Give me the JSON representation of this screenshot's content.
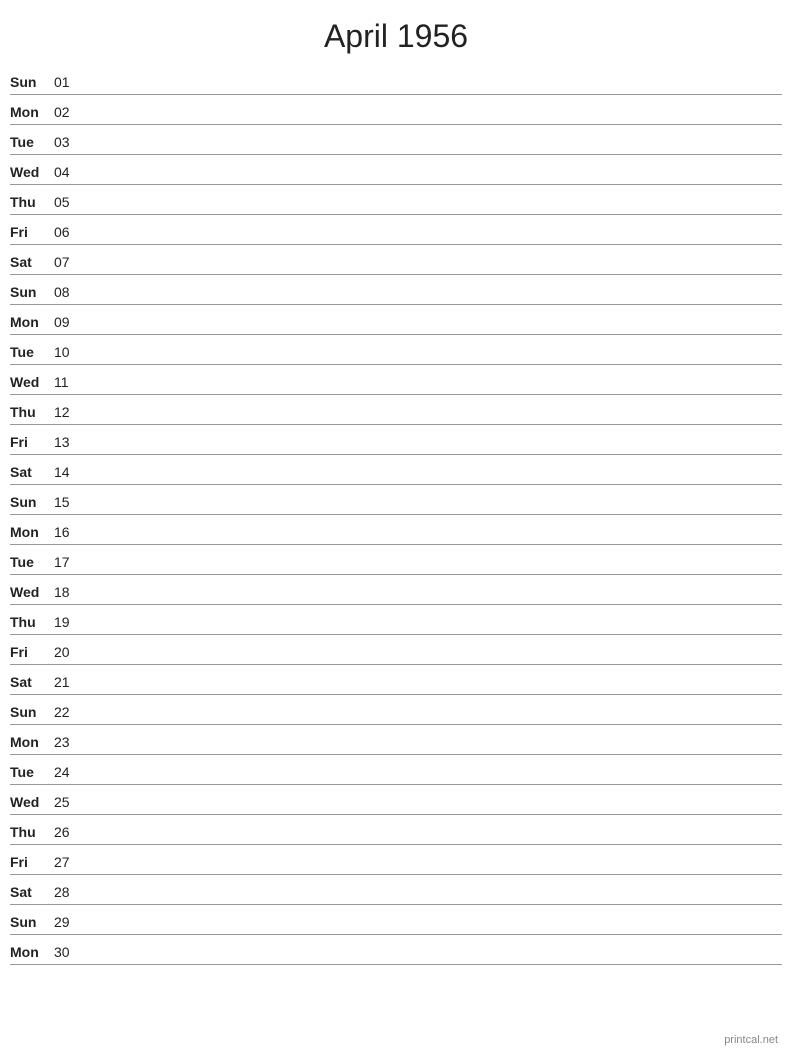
{
  "title": "April 1956",
  "footer": "printcal.net",
  "days": [
    {
      "name": "Sun",
      "number": "01"
    },
    {
      "name": "Mon",
      "number": "02"
    },
    {
      "name": "Tue",
      "number": "03"
    },
    {
      "name": "Wed",
      "number": "04"
    },
    {
      "name": "Thu",
      "number": "05"
    },
    {
      "name": "Fri",
      "number": "06"
    },
    {
      "name": "Sat",
      "number": "07"
    },
    {
      "name": "Sun",
      "number": "08"
    },
    {
      "name": "Mon",
      "number": "09"
    },
    {
      "name": "Tue",
      "number": "10"
    },
    {
      "name": "Wed",
      "number": "11"
    },
    {
      "name": "Thu",
      "number": "12"
    },
    {
      "name": "Fri",
      "number": "13"
    },
    {
      "name": "Sat",
      "number": "14"
    },
    {
      "name": "Sun",
      "number": "15"
    },
    {
      "name": "Mon",
      "number": "16"
    },
    {
      "name": "Tue",
      "number": "17"
    },
    {
      "name": "Wed",
      "number": "18"
    },
    {
      "name": "Thu",
      "number": "19"
    },
    {
      "name": "Fri",
      "number": "20"
    },
    {
      "name": "Sat",
      "number": "21"
    },
    {
      "name": "Sun",
      "number": "22"
    },
    {
      "name": "Mon",
      "number": "23"
    },
    {
      "name": "Tue",
      "number": "24"
    },
    {
      "name": "Wed",
      "number": "25"
    },
    {
      "name": "Thu",
      "number": "26"
    },
    {
      "name": "Fri",
      "number": "27"
    },
    {
      "name": "Sat",
      "number": "28"
    },
    {
      "name": "Sun",
      "number": "29"
    },
    {
      "name": "Mon",
      "number": "30"
    }
  ]
}
